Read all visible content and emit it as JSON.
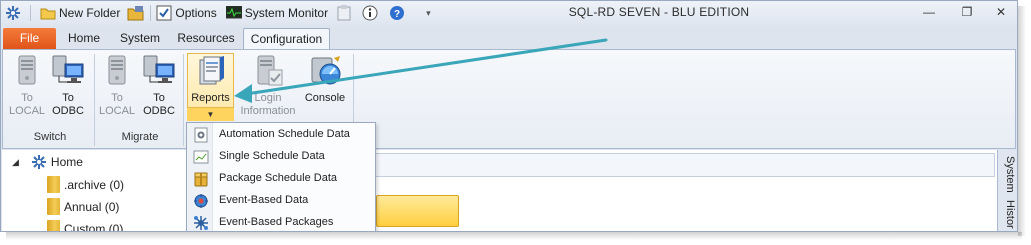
{
  "window": {
    "title": "SQL-RD SEVEN - BLU EDITION"
  },
  "quick_access": {
    "new_folder": "New Folder",
    "options": "Options",
    "system_monitor": "System Monitor",
    "overflow": "▾"
  },
  "window_controls": {
    "minimize": "—",
    "restore": "❐",
    "close": "✕"
  },
  "tabs": [
    {
      "label": "File"
    },
    {
      "label": "Home"
    },
    {
      "label": "System"
    },
    {
      "label": "Resources"
    },
    {
      "label": "Configuration"
    }
  ],
  "ribbon": {
    "groups": [
      {
        "label": "Switch"
      },
      {
        "label": "Migrate"
      }
    ],
    "buttons": {
      "switch_local": {
        "line1": "To",
        "line2": "LOCAL"
      },
      "switch_odbc": {
        "line1": "To",
        "line2": "ODBC"
      },
      "migrate_local": {
        "line1": "To",
        "line2": "LOCAL"
      },
      "migrate_odbc": {
        "line1": "To",
        "line2": "ODBC"
      },
      "reports": {
        "line1": "Reports"
      },
      "login": {
        "line1": "Login",
        "line2": "Information"
      },
      "console": {
        "line1": "Console"
      }
    }
  },
  "reports_menu": {
    "items": [
      {
        "label": "Automation Schedule Data",
        "icon": "automation-icon"
      },
      {
        "label": "Single Schedule Data",
        "icon": "chart-icon"
      },
      {
        "label": "Package Schedule Data",
        "icon": "package-icon"
      },
      {
        "label": "Event-Based Data",
        "icon": "event-icon"
      },
      {
        "label": "Event-Based Packages",
        "icon": "event-package-icon"
      }
    ]
  },
  "tree": {
    "root": "Home",
    "items": [
      {
        "label": ".archive (0)"
      },
      {
        "label": "Annual (0)"
      },
      {
        "label": "Custom (0)"
      }
    ]
  },
  "side_tabs": {
    "system": "System",
    "history": "Histor"
  },
  "colors": {
    "file_tab": "#e0541a",
    "highlight": "#ffd45e",
    "arrow": "#3aa6b9"
  }
}
